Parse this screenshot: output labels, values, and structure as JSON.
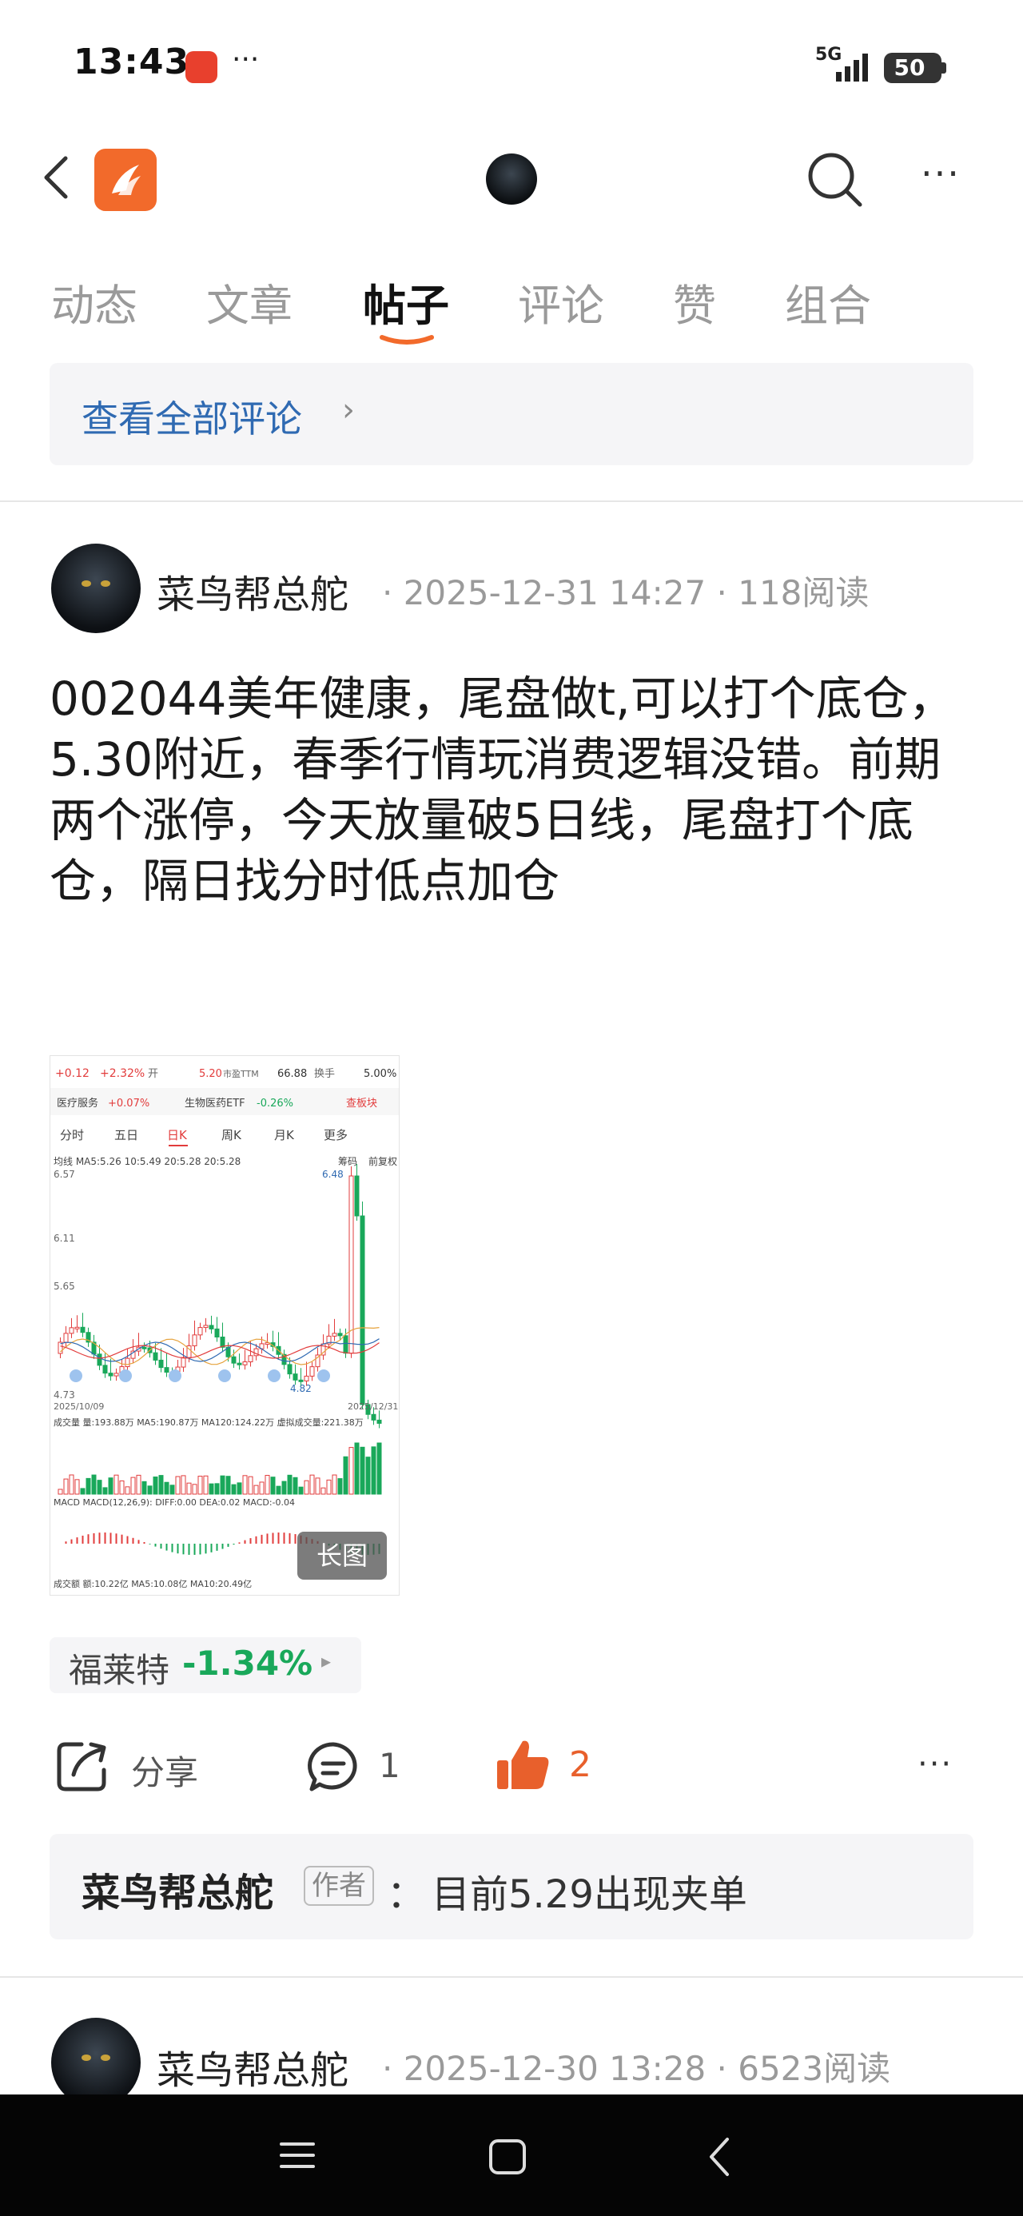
{
  "status_bar": {
    "time": "13:43",
    "dots": "···",
    "network": "5G",
    "battery": "50"
  },
  "header": {
    "back_icon": "chevron-left-icon",
    "logo_icon": "app-logo",
    "search_icon": "search-icon",
    "more_label": "···"
  },
  "tabs": [
    {
      "label": "动态",
      "active": false
    },
    {
      "label": "文章",
      "active": false
    },
    {
      "label": "帖子",
      "active": true
    },
    {
      "label": "评论",
      "active": false
    },
    {
      "label": "赞",
      "active": false
    },
    {
      "label": "组合",
      "active": false
    }
  ],
  "view_all": {
    "label": "查看全部评论",
    "chevron": "›"
  },
  "post": {
    "author": "菜鸟帮总舵",
    "meta": "· 2025-12-31 14:27 · 118阅读",
    "text": "002044美年健康，尾盘做t,可以打个底仓，5.30附近，春季行情玩消费逻辑没错。前期两个涨停，今天放量破5日线，尾盘打个底仓，隔日找分时低点加仓",
    "image_badge": "长图",
    "stock": {
      "name": "福莱特",
      "change": "-1.34%",
      "arrow": "▸"
    },
    "actions": {
      "share": "分享",
      "comments": "1",
      "likes": "2",
      "more": "···"
    },
    "top_comment": {
      "author": "菜鸟帮总舵",
      "badge": "作者",
      "sep": "：",
      "text": "目前5.29出现夹单"
    }
  },
  "next_post": {
    "author": "菜鸟帮总舵",
    "meta": "· 2025-12-30 13:28 · 6523阅读"
  },
  "thumb": {
    "row1": [
      "+0.12",
      "+2.32%",
      "开",
      "5.20",
      "市盈TTM",
      "66.88",
      "换手",
      "5.00%"
    ],
    "row2": [
      "医疗服务",
      "+0.07%",
      "生物医药ETF",
      "-0.26%",
      "查板块"
    ],
    "periods": [
      "分时",
      "五日",
      "日K",
      "周K",
      "月K",
      "更多"
    ],
    "ma_line": "均线  MA5:5.26  10:5.49  20:5.28  20:5.28",
    "ma_right": [
      "筹码",
      "前复权"
    ],
    "y_labels": [
      "6.57",
      "6.11",
      "5.65",
      "4.73"
    ],
    "price_tags": [
      "6.48",
      "4.82"
    ],
    "dates": [
      "2025/10/09",
      "2025/12/31"
    ],
    "volume_line": "成交量   量:193.88万 MA5:190.87万 MA120:124.22万 虚拟成交量:221.38万",
    "macd_line": "MACD   MACD(12,26,9): DIFF:0.00 DEA:0.02 MACD:-0.04",
    "amount_line": "成交额   额:10.22亿 MA5:10.08亿 MA10:20.49亿"
  },
  "nav": {
    "menu_icon": "menu-icon",
    "home_icon": "square-icon",
    "back_icon": "back-icon"
  }
}
